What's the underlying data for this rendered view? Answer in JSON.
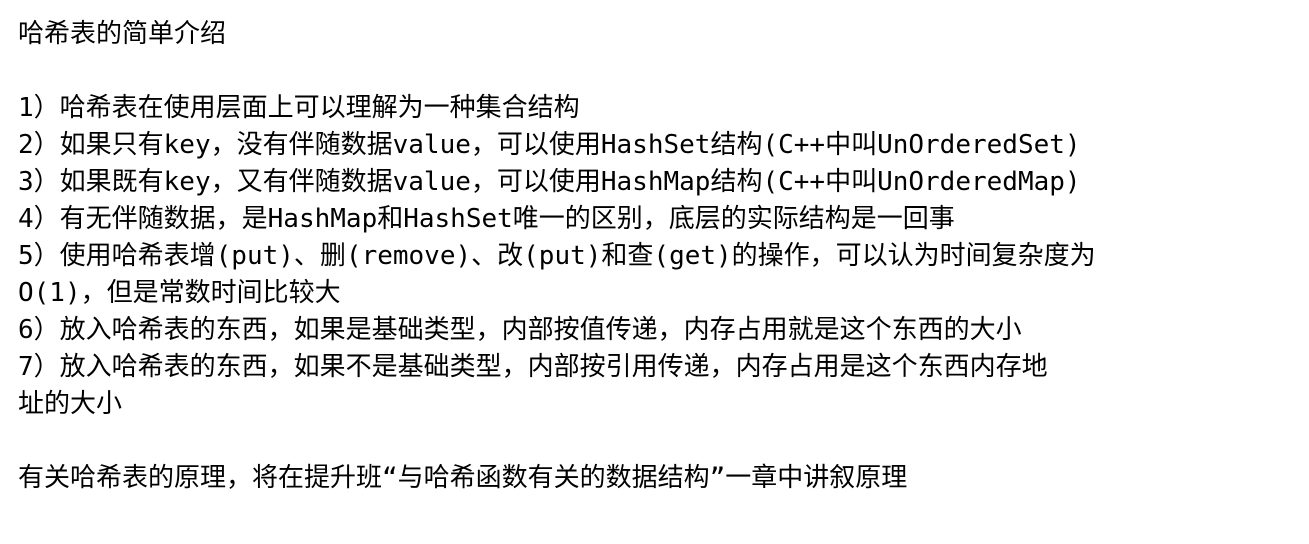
{
  "title": "哈希表的简单介绍",
  "items": [
    "1）哈希表在使用层面上可以理解为一种集合结构",
    "2）如果只有key，没有伴随数据value，可以使用HashSet结构(C++中叫UnOrderedSet)",
    "3）如果既有key，又有伴随数据value，可以使用HashMap结构(C++中叫UnOrderedMap)",
    "4）有无伴随数据，是HashMap和HashSet唯一的区别，底层的实际结构是一回事",
    "5）使用哈希表增(put)、删(remove)、改(put)和查(get)的操作，可以认为时间复杂度为",
    "O(1)，但是常数时间比较大",
    "6）放入哈希表的东西，如果是基础类型，内部按值传递，内存占用就是这个东西的大小",
    "7）放入哈希表的东西，如果不是基础类型，内部按引用传递，内存占用是这个东西内存地",
    "址的大小"
  ],
  "footer": "有关哈希表的原理，将在提升班“与哈希函数有关的数据结构”一章中讲叙原理"
}
